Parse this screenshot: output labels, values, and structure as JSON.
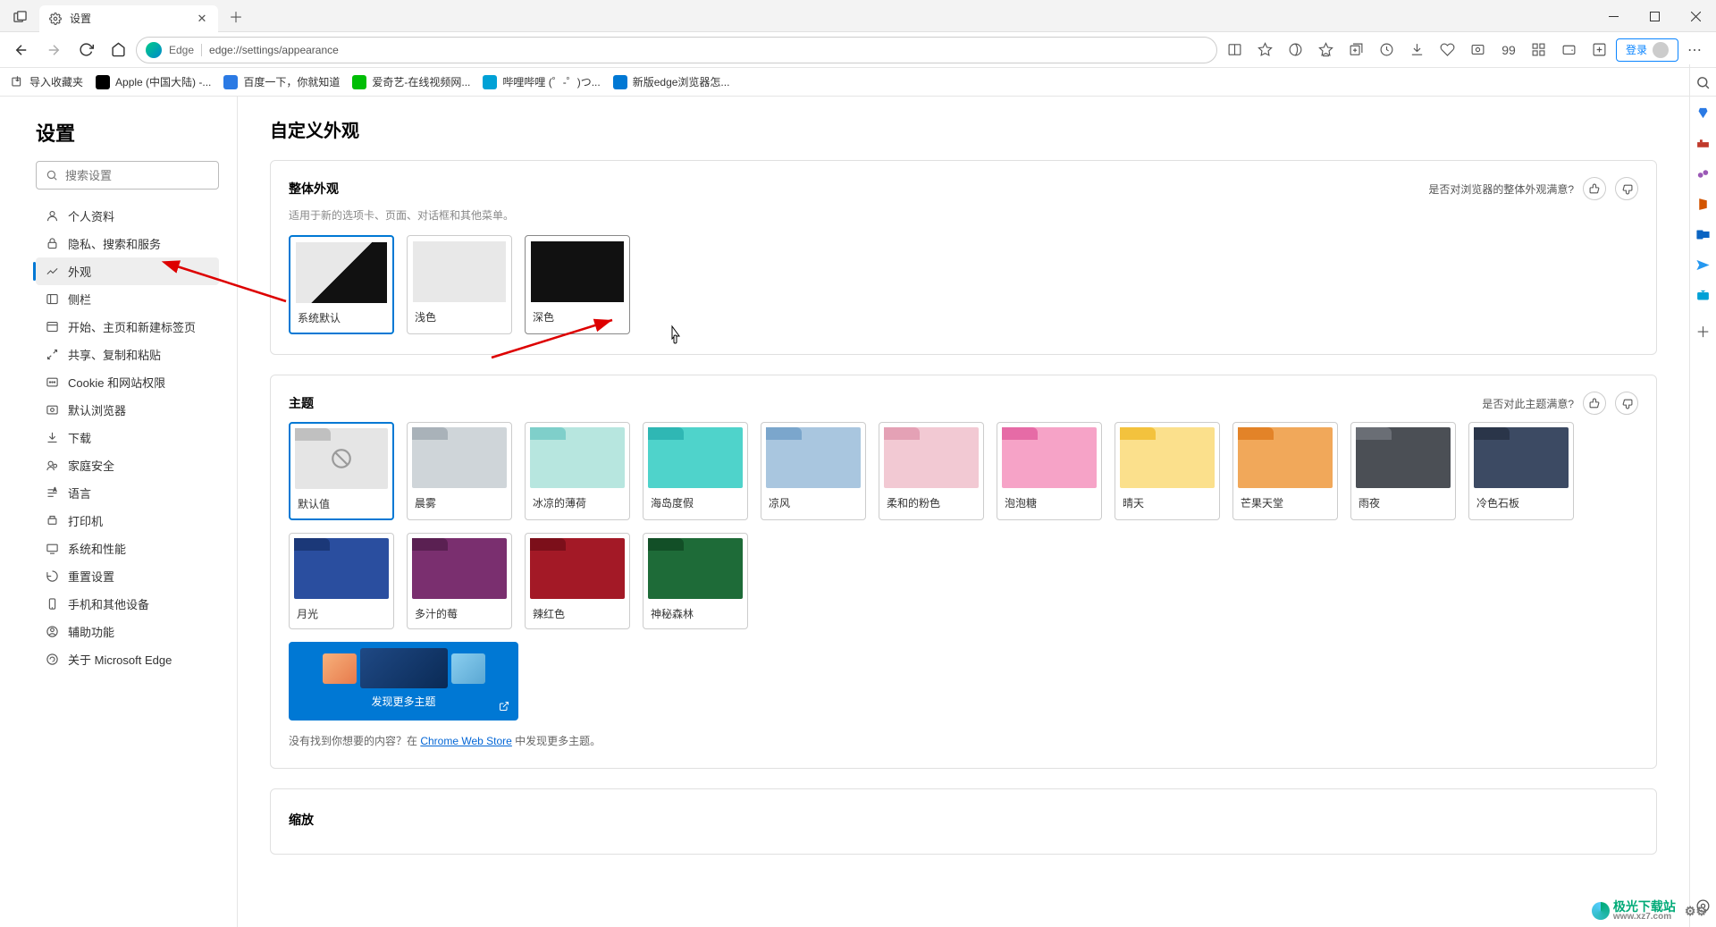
{
  "tab": {
    "title": "设置"
  },
  "toolbar": {
    "site_label": "Edge",
    "url": "edge://settings/appearance",
    "login_label": "登录"
  },
  "bookmarks": {
    "import_label": "导入收藏夹",
    "items": [
      {
        "label": "Apple (中国大陆) -..."
      },
      {
        "label": "百度一下，你就知道"
      },
      {
        "label": "爱奇艺-在线视频网..."
      },
      {
        "label": "哔哩哔哩 (゜-゜)つ..."
      },
      {
        "label": "新版edge浏览器怎..."
      }
    ]
  },
  "settings_sidebar": {
    "title": "设置",
    "search_placeholder": "搜索设置",
    "items": [
      "个人资料",
      "隐私、搜索和服务",
      "外观",
      "侧栏",
      "开始、主页和新建标签页",
      "共享、复制和粘贴",
      "Cookie 和网站权限",
      "默认浏览器",
      "下载",
      "家庭安全",
      "语言",
      "打印机",
      "系统和性能",
      "重置设置",
      "手机和其他设备",
      "辅助功能",
      "关于 Microsoft Edge"
    ],
    "active_index": 2
  },
  "content": {
    "heading": "自定义外观",
    "overall": {
      "title": "整体外观",
      "feedback_q": "是否对浏览器的整体外观满意?",
      "subtitle": "适用于新的选项卡、页面、对话框和其他菜单。",
      "options": [
        "系统默认",
        "浅色",
        "深色"
      ],
      "selected_index": 0
    },
    "themes": {
      "title": "主题",
      "feedback_q": "是否对此主题满意?",
      "items": [
        {
          "label": "默认值",
          "bg": "#e5e5e5",
          "accent": "#c0c0c0",
          "forbid": true
        },
        {
          "label": "晨雾",
          "bg": "#cfd5d9",
          "accent": "#a9b2b9"
        },
        {
          "label": "冰凉的薄荷",
          "bg": "#b7e6df",
          "accent": "#7fcfca"
        },
        {
          "label": "海岛度假",
          "bg": "#4fd3cb",
          "accent": "#2fb7b4"
        },
        {
          "label": "凉风",
          "bg": "#a9c6df",
          "accent": "#7ba6cc"
        },
        {
          "label": "柔和的粉色",
          "bg": "#f2c9d3",
          "accent": "#e4a1b5"
        },
        {
          "label": "泡泡糖",
          "bg": "#f6a3c7",
          "accent": "#e66ba6"
        },
        {
          "label": "晴天",
          "bg": "#fbe08c",
          "accent": "#f3c23d"
        },
        {
          "label": "芒果天堂",
          "bg": "#f1a85a",
          "accent": "#e38328"
        },
        {
          "label": "雨夜",
          "bg": "#4b4f55",
          "accent": "#6a6e75"
        },
        {
          "label": "冷色石板",
          "bg": "#3c4a63",
          "accent": "#2a3549"
        },
        {
          "label": "月光",
          "bg": "#2a4e9f",
          "accent": "#1b3878"
        },
        {
          "label": "多汁的莓",
          "bg": "#7a2f6f",
          "accent": "#5a2052"
        },
        {
          "label": "辣红色",
          "bg": "#a31926",
          "accent": "#7c0f1a"
        },
        {
          "label": "神秘森林",
          "bg": "#1e6b38",
          "accent": "#124f27"
        }
      ],
      "selected_index": 0,
      "discover_label": "发现更多主题",
      "not_found_pre": "没有找到你想要的内容？在 ",
      "chrome_link": "Chrome Web Store",
      "not_found_post": " 中发现更多主题。"
    },
    "zoom_title": "缩放"
  },
  "watermark": {
    "text": "极光下载站",
    "url": "www.xz7.com"
  }
}
